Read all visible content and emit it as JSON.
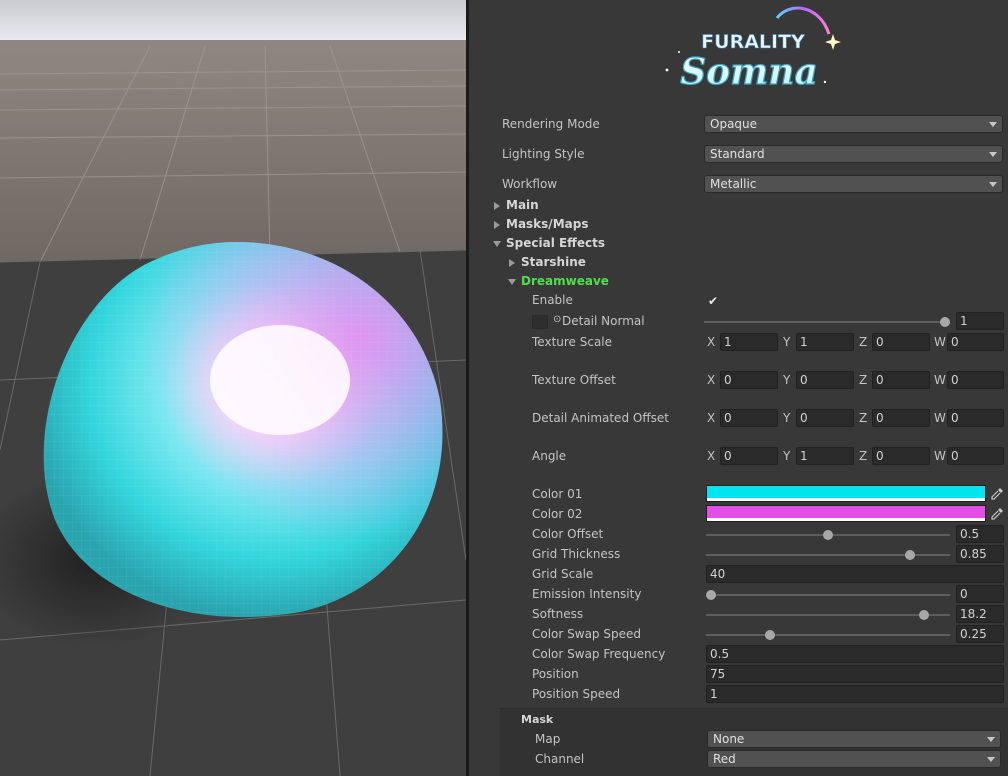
{
  "logo": {
    "top_text": "FURALITY",
    "main_text": "Somna"
  },
  "settings": [
    {
      "label": "Rendering Mode",
      "value": "Opaque"
    },
    {
      "label": "Lighting Style",
      "value": "Standard"
    },
    {
      "label": "Workflow",
      "value": "Metallic"
    }
  ],
  "sections": {
    "main": "Main",
    "masks": "Masks/Maps",
    "special": "Special Effects",
    "starshine": "Starshine",
    "dreamweave": "Dreamweave"
  },
  "dreamweave": {
    "enable_label": "Enable",
    "detail_normal_label": "Detail Normal",
    "detail_normal_value": "1",
    "detail_normal_level": 1.0,
    "axes": [
      "X",
      "Y",
      "Z",
      "W"
    ],
    "vectors": [
      {
        "label": "Texture Scale",
        "values": [
          "1",
          "1",
          "0",
          "0"
        ]
      },
      {
        "label": "Texture Offset",
        "values": [
          "0",
          "0",
          "0",
          "0"
        ]
      },
      {
        "label": "Detail Animated Offset",
        "values": [
          "0",
          "0",
          "0",
          "0"
        ]
      },
      {
        "label": "Angle",
        "values": [
          "0",
          "1",
          "0",
          "0"
        ]
      }
    ],
    "color01_label": "Color 01",
    "color01": "#00e5ef",
    "color02_label": "Color 02",
    "color02": "#e24ee6",
    "sliders": [
      {
        "label": "Color Offset",
        "value": "0.5",
        "level": 0.5
      },
      {
        "label": "Grid Thickness",
        "value": "0.85",
        "level": 0.85
      },
      {
        "label": "Grid Scale",
        "value": "40",
        "level": null
      },
      {
        "label": "Emission Intensity",
        "value": "0",
        "level": 0.0
      },
      {
        "label": "Softness",
        "value": "18.2",
        "level": 0.91
      },
      {
        "label": "Color Swap Speed",
        "value": "0.25",
        "level": 0.25
      },
      {
        "label": "Color Swap Frequency",
        "value": "0.5",
        "level": null
      },
      {
        "label": "Position",
        "value": "75",
        "level": null
      },
      {
        "label": "Position Speed",
        "value": "1",
        "level": null
      }
    ],
    "mask": {
      "title": "Mask",
      "map_label": "Map",
      "map_value": "None",
      "channel_label": "Channel",
      "channel_value": "Red"
    }
  }
}
